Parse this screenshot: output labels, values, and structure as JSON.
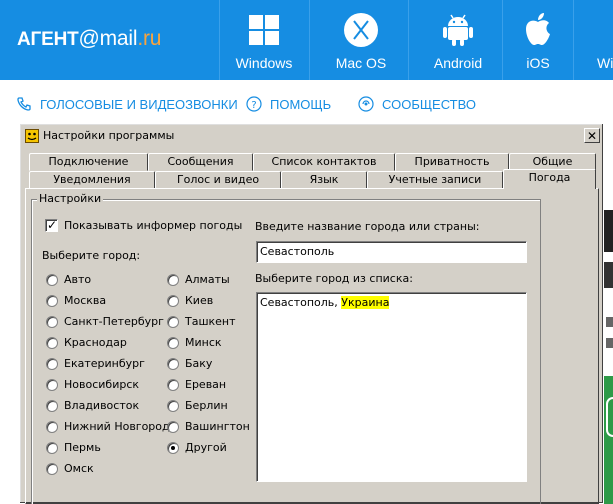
{
  "site": {
    "logo_part1": "АГЕНТ",
    "logo_part2": "@mail",
    "logo_part3": ".ru",
    "brand_color": "#168de2",
    "accent_color": "#f9a43d",
    "platforms": [
      {
        "label": "Windows",
        "icon": "windows-icon"
      },
      {
        "label": "Mac OS",
        "icon": "macos-x-icon"
      },
      {
        "label": "Android",
        "icon": "android-icon"
      },
      {
        "label": "iOS",
        "icon": "apple-icon"
      },
      {
        "label": "Wi",
        "icon": "windows-phone-icon"
      }
    ],
    "nav": [
      {
        "label": "ГОЛОСОВЫЕ И ВИДЕОЗВОНКИ",
        "icon": "phone-icon"
      },
      {
        "label": "ПОМОЩЬ",
        "icon": "help-icon"
      },
      {
        "label": "СООБЩЕСТВО",
        "icon": "community-icon"
      }
    ]
  },
  "dialog": {
    "title": "Настройки программы",
    "close_label": "✕",
    "tabs_row1": [
      "Подключение",
      "Сообщения",
      "Список контактов",
      "Приватность",
      "Общие"
    ],
    "tabs_row2": [
      "Уведомления",
      "Голос и видео",
      "Язык",
      "Учетные записи",
      "Погода"
    ],
    "active_tab": "Погода",
    "group_label": "Настройки",
    "show_weather_label": "Показывать информер погоды",
    "show_weather_checked": true,
    "choose_city_label": "Выберите город:",
    "cities_col1": [
      "Авто",
      "Москва",
      "Санкт-Петербург",
      "Краснодар",
      "Екатеринбург",
      "Новосибирск",
      "Владивосток",
      "Нижний Новгород",
      "Пермь",
      "Омск"
    ],
    "cities_col2": [
      "Алматы",
      "Киев",
      "Ташкент",
      "Минск",
      "Баку",
      "Ереван",
      "Берлин",
      "Вашингтон",
      "Другой"
    ],
    "selected_city": "Другой",
    "enter_city_label": "Введите название города или страны:",
    "city_input_value": "Севастополь",
    "choose_list_label": "Выберите город из списка:",
    "list_item_city": "Севастополь, ",
    "list_item_country": "Украина",
    "highlight_color": "#ffff00"
  }
}
